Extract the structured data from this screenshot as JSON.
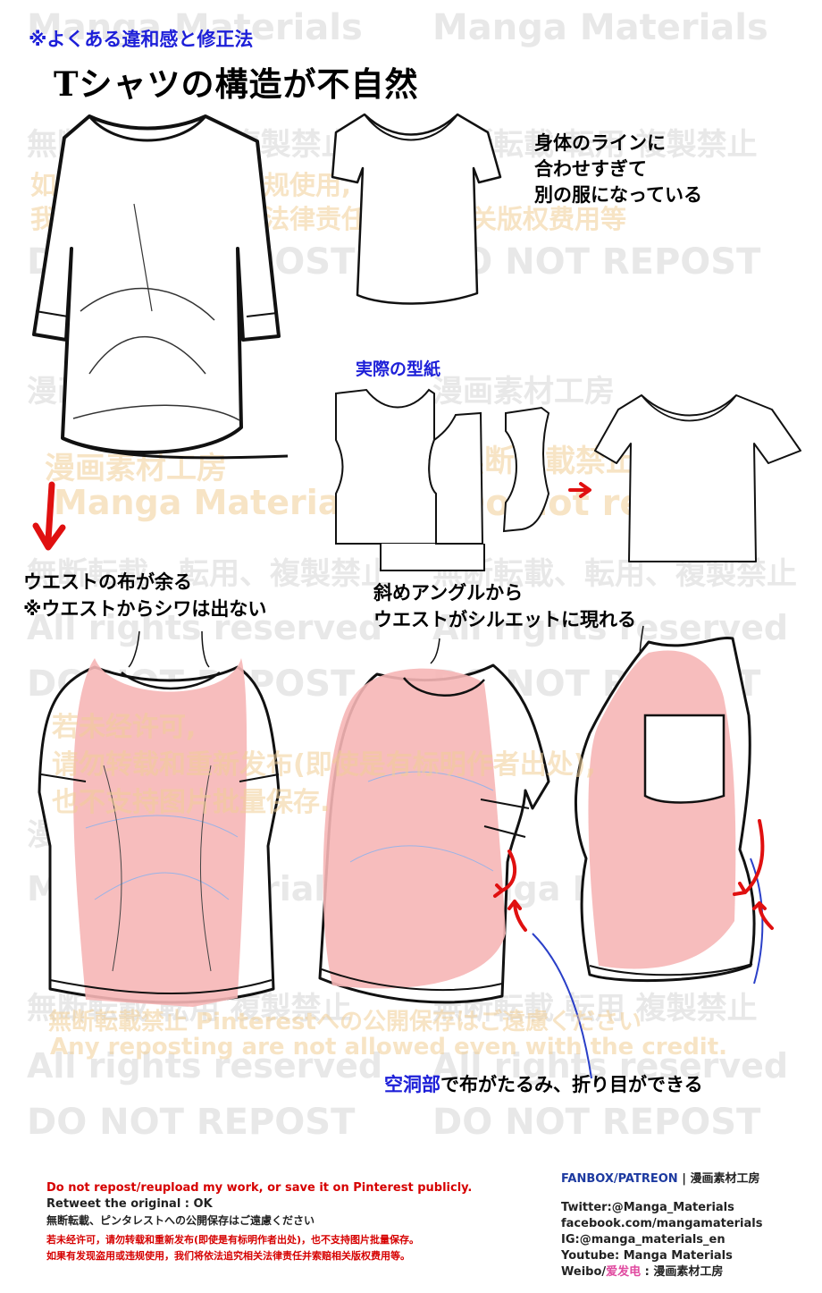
{
  "header": {
    "subtitle": "※よくある違和感と修正法",
    "title": "Tシャツの構造が不自然"
  },
  "notes": {
    "body_line_1": "身体のラインに",
    "body_line_2": "合わせすぎて",
    "body_line_3": "別の服になっている",
    "pattern_label": "実際の型紙",
    "waist_line_1": "ウエストの布が余る",
    "waist_line_2": "※ウエストからシワは出ない",
    "angle_line_1": "斜めアングルから",
    "angle_line_2": "ウエストがシルエットに現れる",
    "hollow_highlight": "空洞部",
    "hollow_rest": "で布がたるみ、折り目ができる"
  },
  "watermarks": {
    "manga_materials": "Manga Materials",
    "no_repost_jp": "無断転載 転用 複製禁止",
    "no_repost_jp2": "無断転載、転用、複製禁止",
    "cn_line_1": "如果有发现盗用或违规使用,",
    "cn_line_2": "我们将依法追究相关法律责任并索赔相关版权费用等",
    "do_not_repost": "DO NOT REPOST",
    "studio_jp": "漫画素材工房",
    "no_repost_short": "無断転載禁止",
    "do_not_repost_lower": "Do not repost",
    "all_rights": "All rights reserved",
    "cn_line_3": "若未经许可,",
    "cn_line_4": "请勿转载和重新发布(即使是有标明作者出处),",
    "cn_line_5": "也不支持图片批量保存.",
    "pinterest": "無断転載禁止 Pinterestへの公開保存はご遠慮ください",
    "any_reposting": "Any reposting are not allowed even with the credit."
  },
  "footer": {
    "left_1": "Do not repost/reupload my work, or save it on Pinterest publicly.",
    "left_2": "Retweet the original : OK",
    "left_3": "無断転載、ピンタレストへの公開保存はご遠慮ください",
    "left_4": "若未经许可，请勿转载和重新发布(即使是有标明作者出处)，也不支持图片批量保存。",
    "left_5": "如果有发现盗用或违规使用，我们将依法追究相关法律责任并索赔相关版权费用等。",
    "right_head_a": "FANBOX/PATREON",
    "right_head_sep": " | ",
    "right_head_b": "漫画素材工房",
    "twitter": "Twitter:@Manga_Materials",
    "facebook": "facebook.com/mangamaterials",
    "ig": "IG:@manga_materials_en",
    "youtube": "Youtube: Manga Materials",
    "weibo_a": "Weibo/",
    "weibo_b": "爱发电",
    "weibo_c": " : 漫画素材工房"
  },
  "colors": {
    "accent_blue": "#1d1fd8",
    "arrow_red": "#e01010",
    "shirt_fill": "#f6b6b6",
    "footer_red": "#d60000"
  }
}
